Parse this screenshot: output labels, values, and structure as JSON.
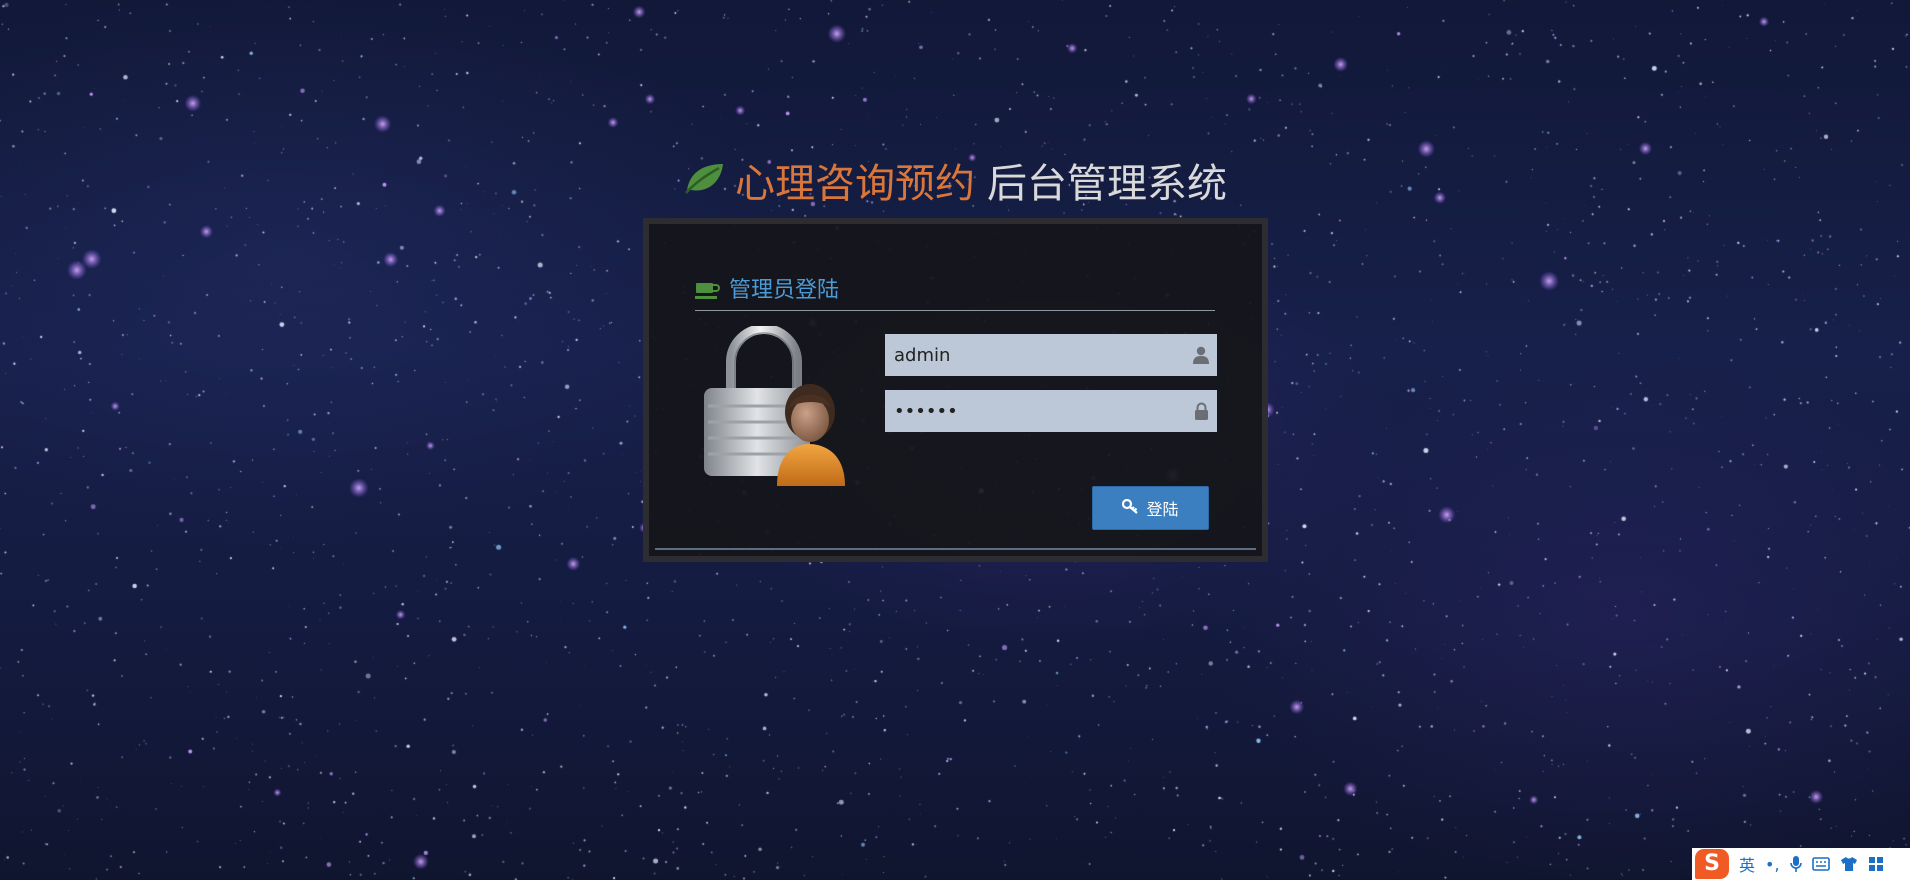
{
  "header": {
    "brand": "心理咨询预约",
    "subtitle": "后台管理系统"
  },
  "login_panel": {
    "heading": "管理员登陆",
    "username_value": "admin",
    "password_value": "••••••",
    "login_button_label": "登陆"
  },
  "ime_toolbar": {
    "logo_letter": "S",
    "mode_label": "英",
    "punctuation_label": "•,"
  },
  "colors": {
    "brand": "#d9763a",
    "heading_blue": "#4c9bd6",
    "leaf_green": "#4d8f3e",
    "button_blue": "#3b7fc0",
    "input_bg": "#bcc8d8",
    "ime_orange": "#f05a24"
  },
  "icons": {
    "title": "leaf-icon",
    "heading": "coffee-cup-icon",
    "username": "user-icon",
    "password": "lock-icon",
    "button": "key-icon"
  }
}
